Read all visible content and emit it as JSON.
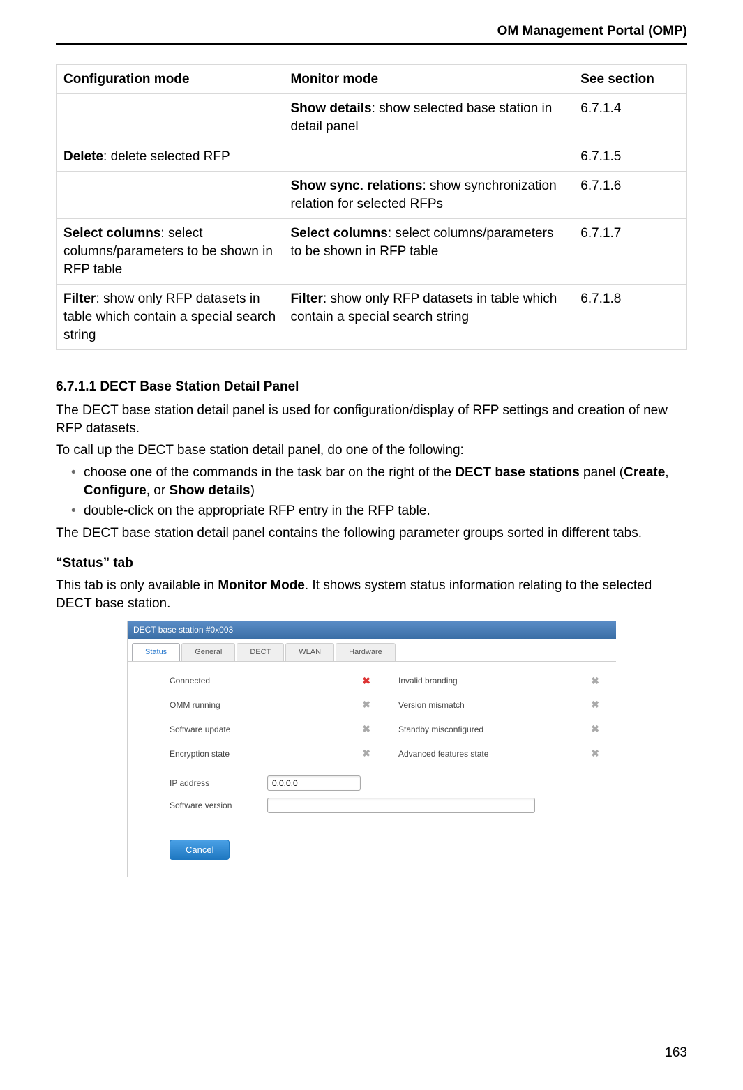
{
  "header": {
    "running_title": "OM Management Portal (OMP)"
  },
  "table": {
    "head": {
      "config_mode": "Configuration mode",
      "monitor_mode": "Monitor mode",
      "see_section": "See section"
    },
    "rows": [
      {
        "config_bold": "",
        "config_rest": "",
        "monitor_bold": "Show details",
        "monitor_rest": ": show selected base station in detail panel",
        "section": "6.7.1.4"
      },
      {
        "config_bold": "Delete",
        "config_rest": ": delete selected RFP",
        "monitor_bold": "",
        "monitor_rest": "",
        "section": "6.7.1.5"
      },
      {
        "config_bold": "",
        "config_rest": "",
        "monitor_bold": "Show sync. relations",
        "monitor_rest": ": show synchronization relation for selected RFPs",
        "section": "6.7.1.6"
      },
      {
        "config_bold": "Select columns",
        "config_rest": ": select columns/parameters to be shown in RFP table",
        "monitor_bold": "Select columns",
        "monitor_rest": ": select columns/parameters to be shown in RFP table",
        "section": "6.7.1.7"
      },
      {
        "config_bold": "Filter",
        "config_rest": ": show only RFP datasets in table which contain a special search string",
        "monitor_bold": "Filter",
        "monitor_rest": ": show only RFP datasets in table which contain a special search string",
        "section": "6.7.1.8"
      }
    ]
  },
  "section": {
    "number": "6.7.1.1",
    "title": "DECT Base Station Detail Panel",
    "p1": "The DECT base station detail panel is used for configuration/display of RFP settings and creation of new RFP datasets.",
    "p2": "To call up the DECT base station detail panel, do one of the following:",
    "bullet1_pre": "choose one of the commands in the task bar on the right of the ",
    "bullet1_bold1": "DECT base stations",
    "bullet1_mid": " panel (",
    "bullet1_bold2": "Create",
    "bullet1_sep1": ", ",
    "bullet1_bold3": "Configure",
    "bullet1_sep2": ", or ",
    "bullet1_bold4": "Show details",
    "bullet1_post": ")",
    "bullet2": "double-click on the appropriate RFP entry in the RFP table.",
    "p3": "The DECT base station detail panel contains the following parameter groups sorted in different tabs."
  },
  "status_block": {
    "heading": "“Status” tab",
    "para_pre": "This tab is only available in ",
    "para_bold": "Monitor Mode",
    "para_post": ". It shows system status information relating to the selected DECT base station."
  },
  "panel": {
    "title": "DECT base station #0x003",
    "tabs": [
      "Status",
      "General",
      "DECT",
      "WLAN",
      "Hardware"
    ],
    "left_fields": [
      {
        "label": "Connected",
        "icon": "x-red"
      },
      {
        "label": "OMM running",
        "icon": "x-gray"
      },
      {
        "label": "Software update",
        "icon": "x-gray"
      },
      {
        "label": "Encryption state",
        "icon": "x-gray"
      }
    ],
    "right_fields": [
      {
        "label": "Invalid branding",
        "icon": "x-gray"
      },
      {
        "label": "Version mismatch",
        "icon": "x-gray"
      },
      {
        "label": "Standby misconfigured",
        "icon": "x-gray"
      },
      {
        "label": "Advanced features state",
        "icon": "x-gray"
      }
    ],
    "ip_label": "IP address",
    "ip_value": "0.0.0.0",
    "sw_label": "Software version",
    "sw_value": "",
    "cancel": "Cancel"
  },
  "page_number": "163"
}
